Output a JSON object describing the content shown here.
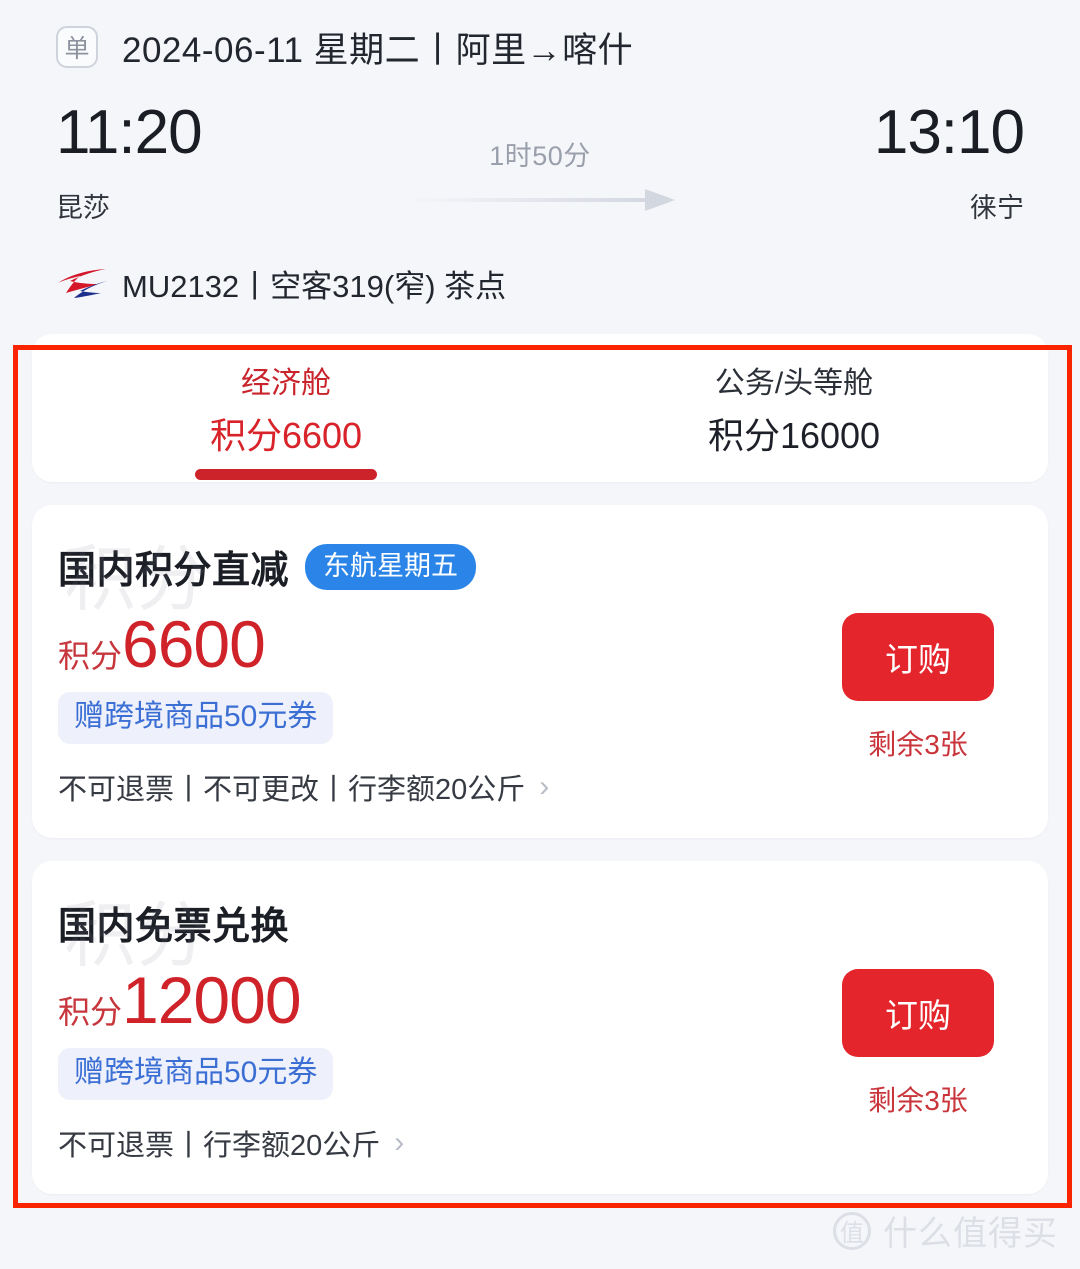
{
  "header": {
    "trip_type_badge": "单",
    "date_route": "2024-06-11 星期二丨阿里→喀什"
  },
  "itinerary": {
    "departure": {
      "time": "11:20",
      "airport": "昆莎"
    },
    "arrival": {
      "time": "13:10",
      "airport": "徕宁"
    },
    "duration": "1时50分",
    "flight_no": "MU2132",
    "aircraft_meal": "丨空客319(窄) 茶点",
    "airline_logo": "china-eastern-logo"
  },
  "cabin_tabs": [
    {
      "name": "经济舱",
      "points": "积分6600",
      "active": true
    },
    {
      "name": "公务/头等舱",
      "points": "积分16000",
      "active": false
    }
  ],
  "fares": [
    {
      "title": "国内积分直减",
      "tag": "东航星期五",
      "price_unit": "积分",
      "price_value": "6600",
      "watermark": "积分",
      "coupon": "赠跨境商品50元券",
      "rules": "不可退票丨不可更改丨行李额20公斤",
      "chevron": "›",
      "order_label": "订购",
      "remaining": "剩余3张"
    },
    {
      "title": "国内免票兑换",
      "tag": "",
      "price_unit": "积分",
      "price_value": "12000",
      "watermark": "积分",
      "coupon": "赠跨境商品50元券",
      "rules": "不可退票丨行李额20公斤",
      "chevron": "›",
      "order_label": "订购",
      "remaining": "剩余3张"
    }
  ],
  "watermark": {
    "logo_char": "值",
    "text": "什么值得买"
  },
  "colors": {
    "accent_red": "#cf2229",
    "button_red": "#e4262c",
    "tag_blue": "#2b85e8",
    "coupon_blue": "#3b6fd4",
    "annotation_red": "#fa2400",
    "page_bg": "#f5f6fa"
  }
}
